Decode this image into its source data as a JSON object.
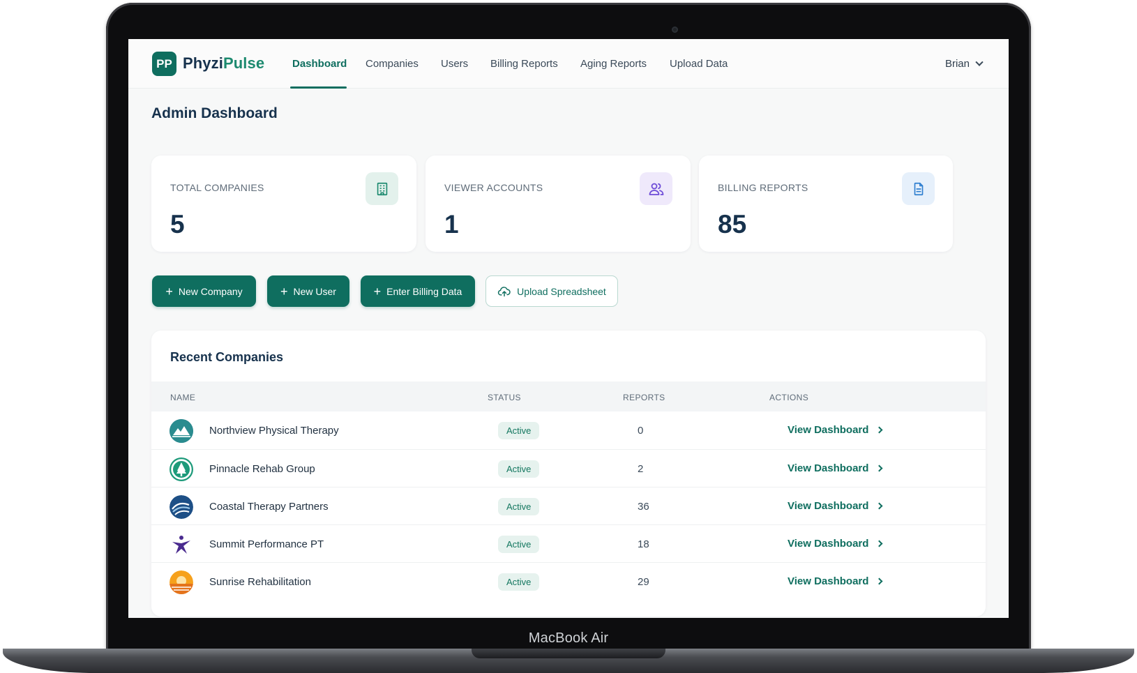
{
  "device": {
    "label": "MacBook Air"
  },
  "navbar": {
    "logo_initials": "PP",
    "brand_part1": "Phyzi",
    "brand_part2": "Pulse",
    "items": [
      {
        "label": "Dashboard",
        "active": true
      },
      {
        "label": "Companies"
      },
      {
        "label": "Users"
      },
      {
        "label": "Billing Reports"
      },
      {
        "label": "Aging Reports"
      },
      {
        "label": "Upload Data"
      }
    ],
    "user_name": "Brian"
  },
  "page": {
    "title": "Admin Dashboard"
  },
  "stats": [
    {
      "label": "TOTAL COMPANIES",
      "value": "5",
      "icon": "building-icon",
      "icon_color": "#1d8a6f",
      "icon_bg": "#e3f1ec"
    },
    {
      "label": "VIEWER ACCOUNTS",
      "value": "1",
      "icon": "users-icon",
      "icon_color": "#6d4bd8",
      "icon_bg": "#efe9fb"
    },
    {
      "label": "BILLING REPORTS",
      "value": "85",
      "icon": "document-icon",
      "icon_color": "#2f7fd0",
      "icon_bg": "#e6f0fb"
    }
  ],
  "actions": {
    "new_company": "New Company",
    "new_user": "New User",
    "enter_billing": "Enter Billing Data",
    "upload_spreadsheet": "Upload Spreadsheet"
  },
  "recent_companies": {
    "title": "Recent Companies",
    "columns": [
      "NAME",
      "STATUS",
      "REPORTS",
      "ACTIONS"
    ],
    "rows": [
      {
        "name": "Northview Physical Therapy",
        "status": "Active",
        "reports": "0",
        "action": "View Dashboard",
        "logo": "mountain-logo-icon"
      },
      {
        "name": "Pinnacle Rehab Group",
        "status": "Active",
        "reports": "2",
        "action": "View Dashboard",
        "logo": "tree-logo-icon"
      },
      {
        "name": "Coastal Therapy Partners",
        "status": "Active",
        "reports": "36",
        "action": "View Dashboard",
        "logo": "wave-logo-icon"
      },
      {
        "name": "Summit Performance PT",
        "status": "Active",
        "reports": "18",
        "action": "View Dashboard",
        "logo": "star-figure-logo-icon"
      },
      {
        "name": "Sunrise Rehabilitation",
        "status": "Active",
        "reports": "29",
        "action": "View Dashboard",
        "logo": "sun-logo-icon"
      }
    ]
  },
  "colors": {
    "primary": "#0f6e5f",
    "text_dark": "#17324d",
    "badge_bg": "#e6f2ee"
  }
}
